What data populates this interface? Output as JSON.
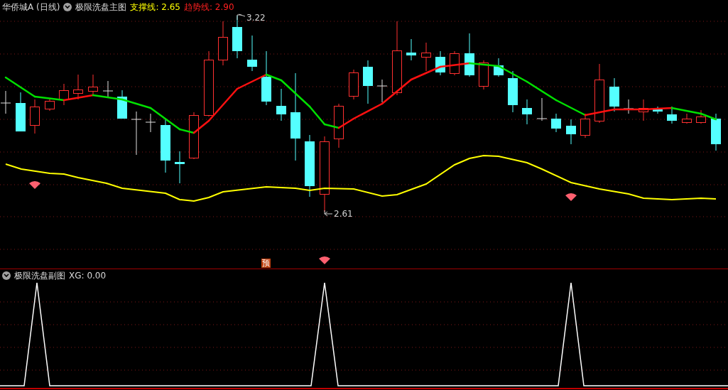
{
  "main_panel": {
    "stock": "华侨城A (日线)",
    "indicator": "极限洗盘主图",
    "support_label": "支撑线: 2.65",
    "trend_label": "趋势线: 2.90",
    "high_marker": "3.22",
    "low_marker": "2.61",
    "forecast_badge": "预"
  },
  "sub_panel": {
    "indicator": "极限洗盘副图",
    "value_label": "XG: 0.00"
  }
}
